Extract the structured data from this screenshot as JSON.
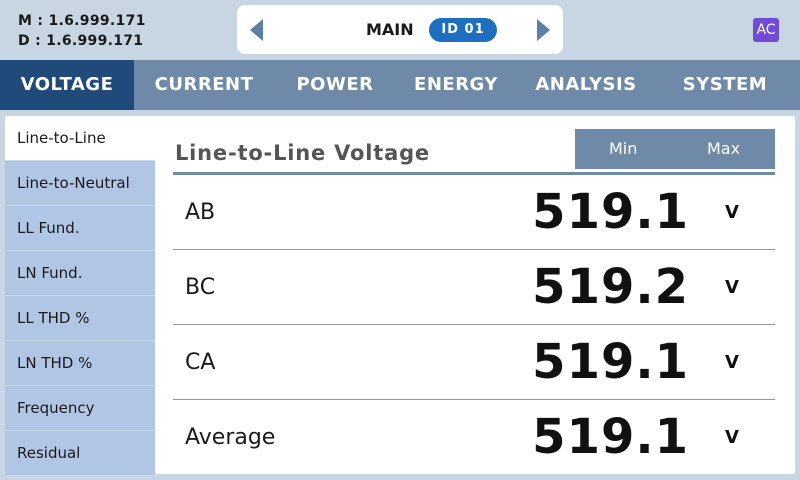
{
  "header": {
    "firmware_m": "M : 1.6.999.171",
    "firmware_d": "D : 1.6.999.171",
    "nav_title": "MAIN",
    "device_id": "ID 01",
    "ac_badge": "AC"
  },
  "tabs": [
    {
      "label": "VOLTAGE"
    },
    {
      "label": "CURRENT"
    },
    {
      "label": "POWER"
    },
    {
      "label": "ENERGY"
    },
    {
      "label": "ANALYSIS"
    },
    {
      "label": "SYSTEM"
    }
  ],
  "sidebar": {
    "items": [
      {
        "label": "Line-to-Line"
      },
      {
        "label": "Line-to-Neutral"
      },
      {
        "label": "LL Fund."
      },
      {
        "label": "LN Fund."
      },
      {
        "label": "LL THD %"
      },
      {
        "label": "LN THD %"
      },
      {
        "label": "Frequency"
      },
      {
        "label": "Residual"
      }
    ]
  },
  "panel": {
    "title": "Line-to-Line Voltage",
    "min_label": "Min",
    "max_label": "Max",
    "rows": [
      {
        "label": "AB",
        "value": "519.1",
        "unit": "V"
      },
      {
        "label": "BC",
        "value": "519.2",
        "unit": "V"
      },
      {
        "label": "CA",
        "value": "519.1",
        "unit": "V"
      },
      {
        "label": "Average",
        "value": "519.1",
        "unit": "V"
      }
    ]
  },
  "colors": {
    "background": "#c8d6e3",
    "tab_bar": "#6e8aa8",
    "tab_active": "#1f4a7a",
    "sidebar_item": "#b1c6e5",
    "id_badge": "#1e6fbf",
    "ac_badge": "#6f4bd6"
  },
  "icons": {
    "prev": "caret-left-icon",
    "next": "caret-right-icon"
  }
}
